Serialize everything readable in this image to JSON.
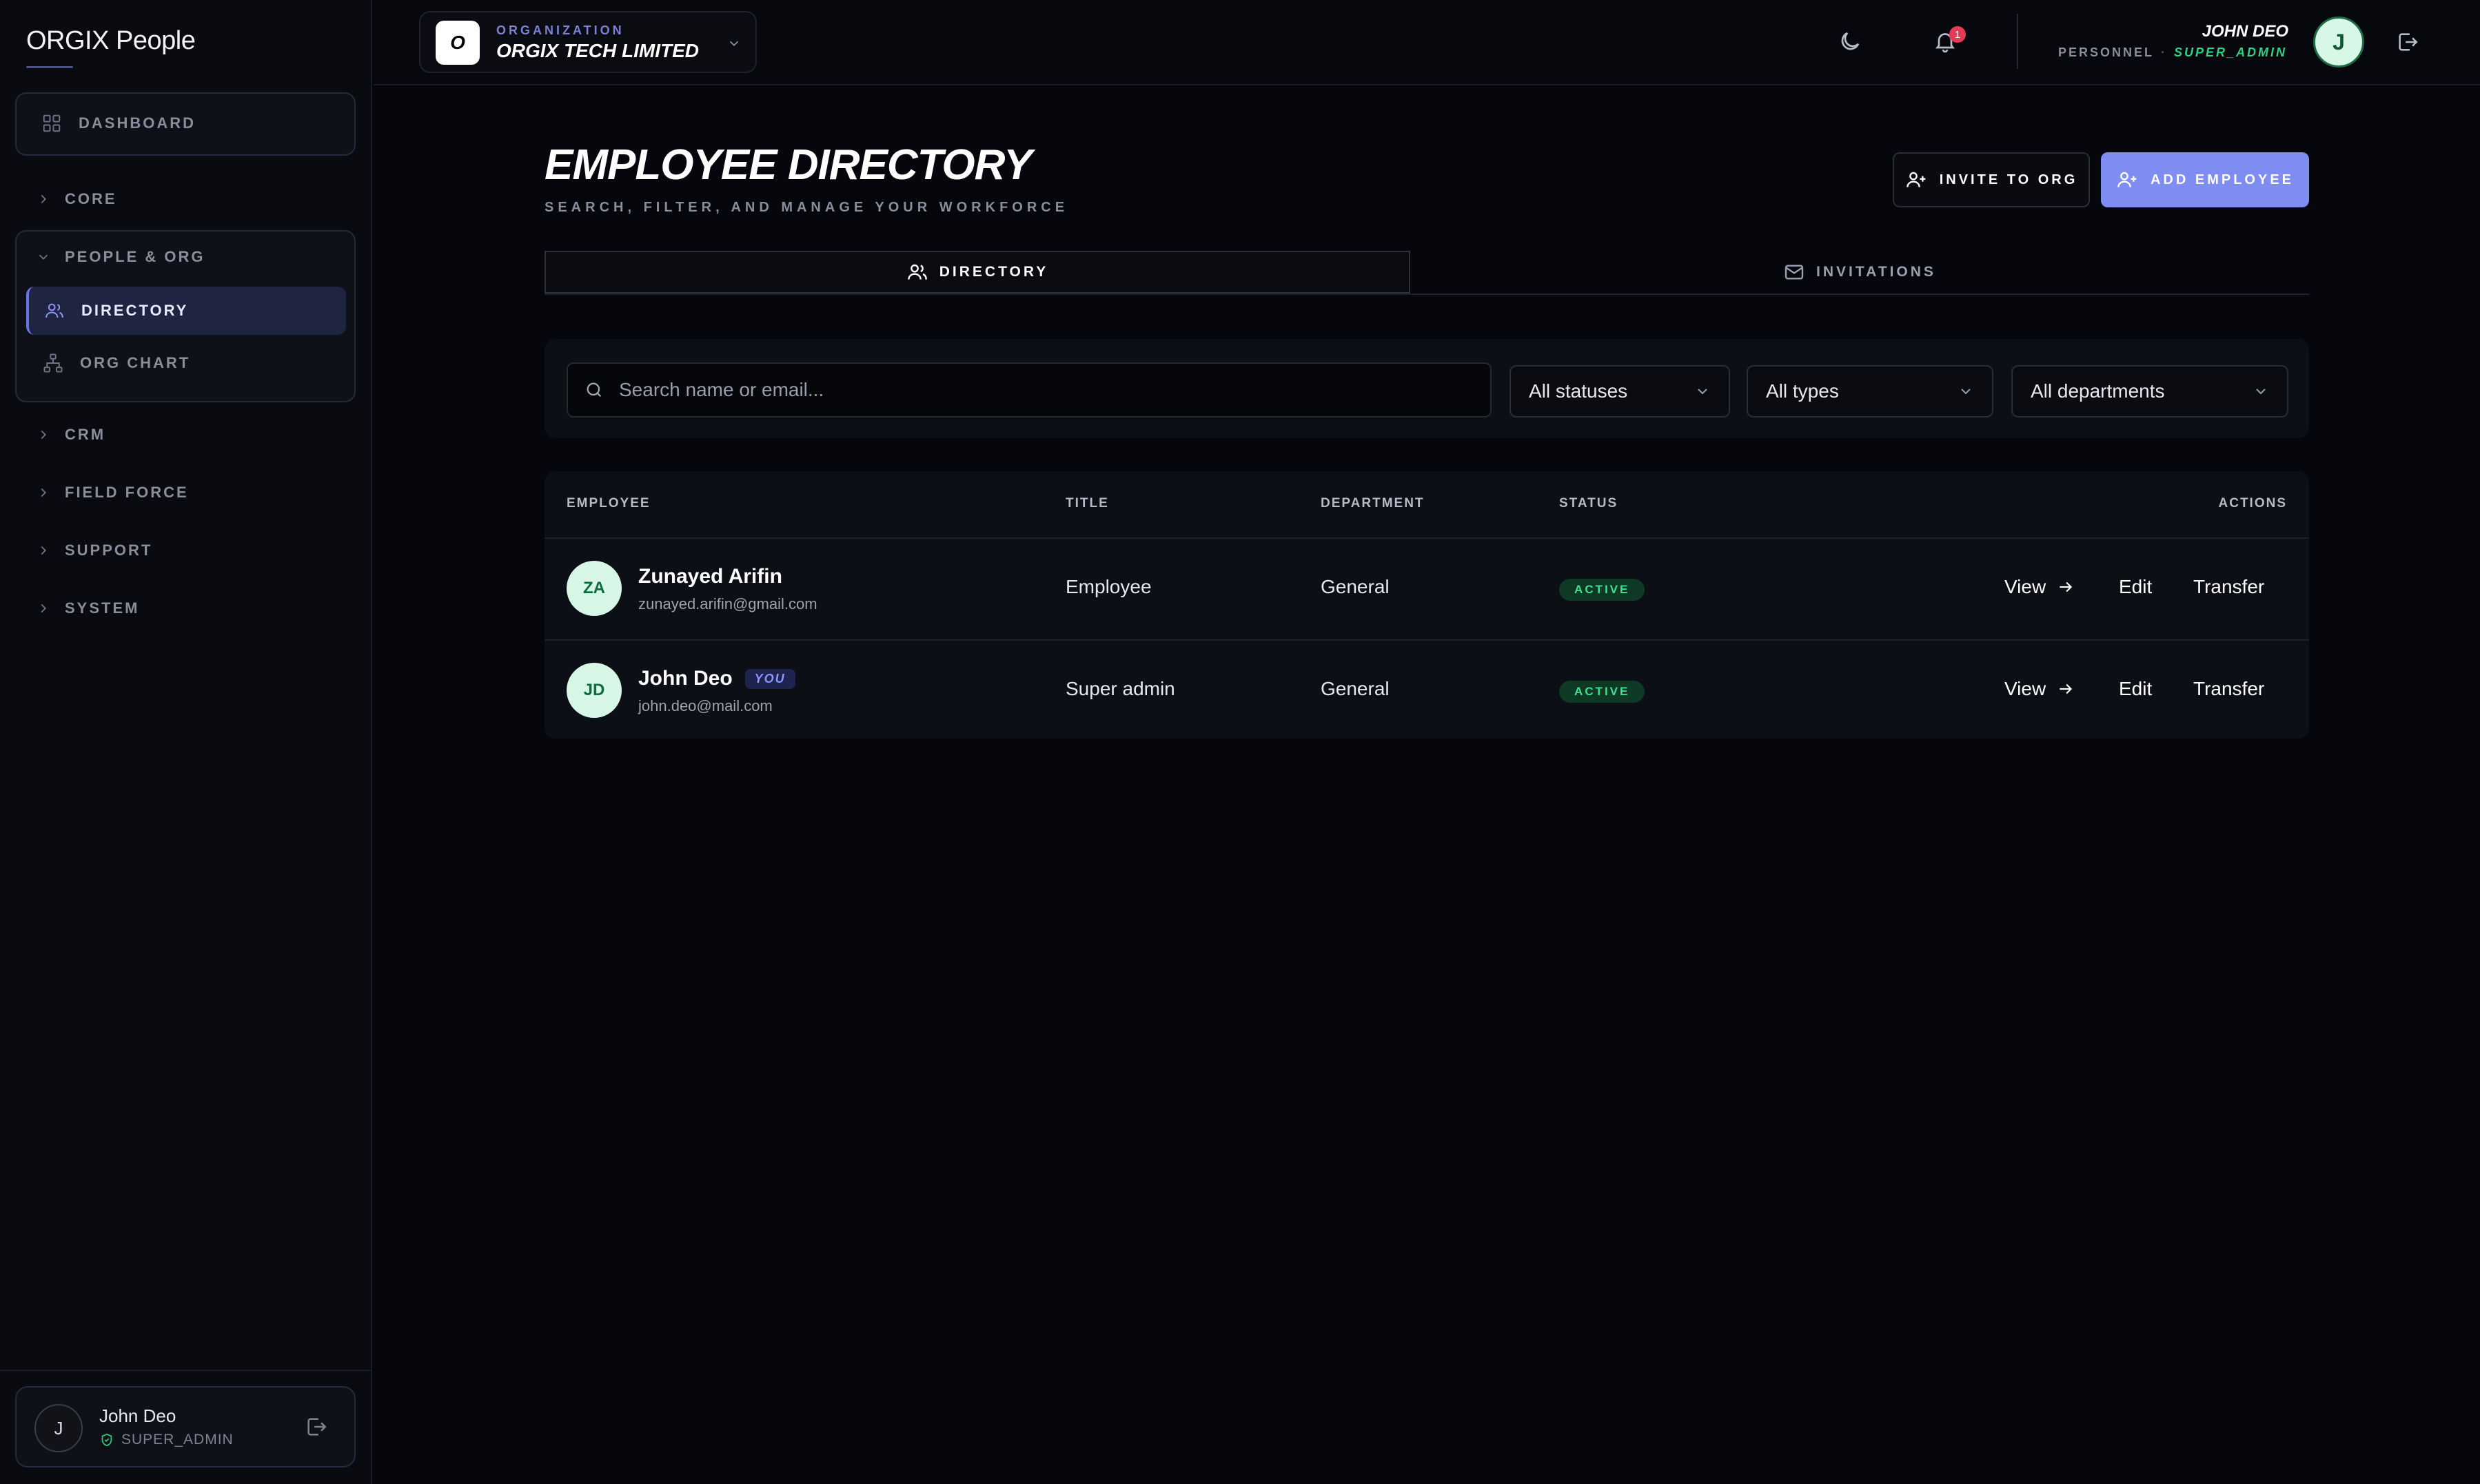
{
  "sidebar": {
    "brand": "ORGIX People",
    "dashboard": "DASHBOARD",
    "sections": [
      {
        "label": "CORE"
      },
      {
        "label": "PEOPLE & ORG"
      },
      {
        "label": "CRM"
      },
      {
        "label": "FIELD FORCE"
      },
      {
        "label": "SUPPORT"
      },
      {
        "label": "SYSTEM"
      }
    ],
    "people_items": [
      {
        "label": "DIRECTORY",
        "active": true
      },
      {
        "label": "ORG CHART",
        "active": false
      }
    ],
    "footer": {
      "avatar_initial": "J",
      "name": "John Deo",
      "role": "SUPER_ADMIN"
    }
  },
  "topbar": {
    "org_caption": "ORGANIZATION",
    "org_logo_letter": "O",
    "org_name": "ORGIX TECH LIMITED",
    "notification_count": "1",
    "user_name": "JOHN DEO",
    "user_context": "PERSONNEL",
    "user_role": "SUPER_ADMIN",
    "user_avatar_initial": "J"
  },
  "page": {
    "title": "EMPLOYEE DIRECTORY",
    "subtitle": "SEARCH, FILTER, AND MANAGE YOUR WORKFORCE",
    "invite_button": "INVITE TO ORG",
    "add_button": "ADD EMPLOYEE",
    "tabs": [
      {
        "label": "DIRECTORY",
        "active": true
      },
      {
        "label": "INVITATIONS",
        "active": false
      }
    ]
  },
  "filters": {
    "search_placeholder": "Search name or email...",
    "status": "All statuses",
    "type": "All types",
    "department": "All departments"
  },
  "table": {
    "headers": {
      "employee": "EMPLOYEE",
      "title": "TITLE",
      "department": "DEPARTMENT",
      "status": "STATUS",
      "actions": "ACTIONS"
    },
    "rows": [
      {
        "initials": "ZA",
        "name": "Zunayed Arifin",
        "email": "zunayed.arifin@gmail.com",
        "title": "Employee",
        "department": "General",
        "status": "ACTIVE",
        "is_you": false
      },
      {
        "initials": "JD",
        "name": "John Deo",
        "you_label": "YOU",
        "email": "john.deo@mail.com",
        "title": "Super admin",
        "department": "General",
        "status": "ACTIVE",
        "is_you": true
      }
    ],
    "actions": {
      "view": "View",
      "edit": "Edit",
      "transfer": "Transfer"
    }
  },
  "colors": {
    "accent": "#7f8cf2",
    "active_status": "#3fe08f",
    "background": "#06070d"
  }
}
